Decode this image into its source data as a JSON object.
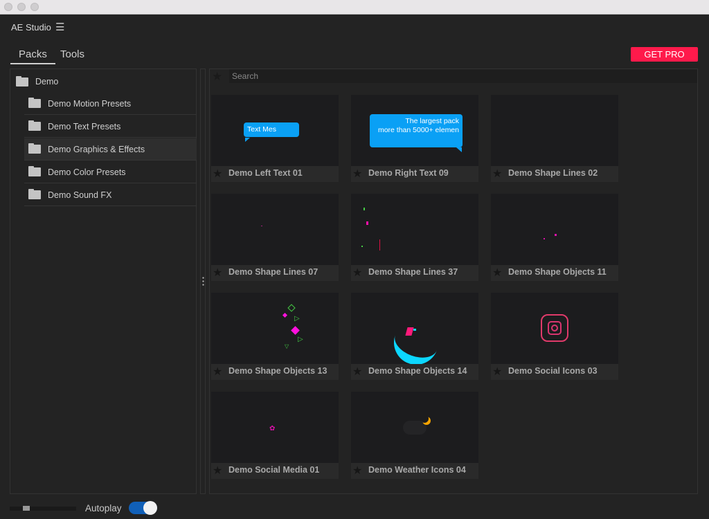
{
  "window": {
    "app_title": "AE Studio",
    "menu_icon": "hamburger-icon"
  },
  "tabs": [
    {
      "label": "Packs",
      "active": true
    },
    {
      "label": "Tools",
      "active": false
    }
  ],
  "get_pro_label": "GET PRO",
  "colors": {
    "accent": "#ff1a4b",
    "toggle": "#1160b8",
    "bubble": "#0aa0f5"
  },
  "tree": {
    "root": "Demo",
    "items": [
      {
        "label": "Demo Motion Presets",
        "selected": false
      },
      {
        "label": "Demo Text Presets",
        "selected": false
      },
      {
        "label": "Demo Graphics & Effects",
        "selected": true
      },
      {
        "label": "Demo Color Presets",
        "selected": false
      },
      {
        "label": "Demo Sound FX",
        "selected": false
      }
    ]
  },
  "search": {
    "placeholder": "Search",
    "value": ""
  },
  "presets": [
    {
      "label": "Demo Left Text 01",
      "bubble": "Text Mes"
    },
    {
      "label": "Demo Right Text 09",
      "bubble": "The largest pack\nmore than 5000+ elemen"
    },
    {
      "label": "Demo Shape Lines 02"
    },
    {
      "label": "Demo Shape Lines 07"
    },
    {
      "label": "Demo Shape Lines 37"
    },
    {
      "label": "Demo Shape Objects 11"
    },
    {
      "label": "Demo Shape Objects 13"
    },
    {
      "label": "Demo Shape Objects 14"
    },
    {
      "label": "Demo Social Icons 03"
    },
    {
      "label": "Demo Social Media 01"
    },
    {
      "label": "Demo Weather Icons 04"
    }
  ],
  "footer": {
    "autoplay_label": "Autoplay",
    "autoplay_on": true,
    "size_slider": 0.2
  }
}
